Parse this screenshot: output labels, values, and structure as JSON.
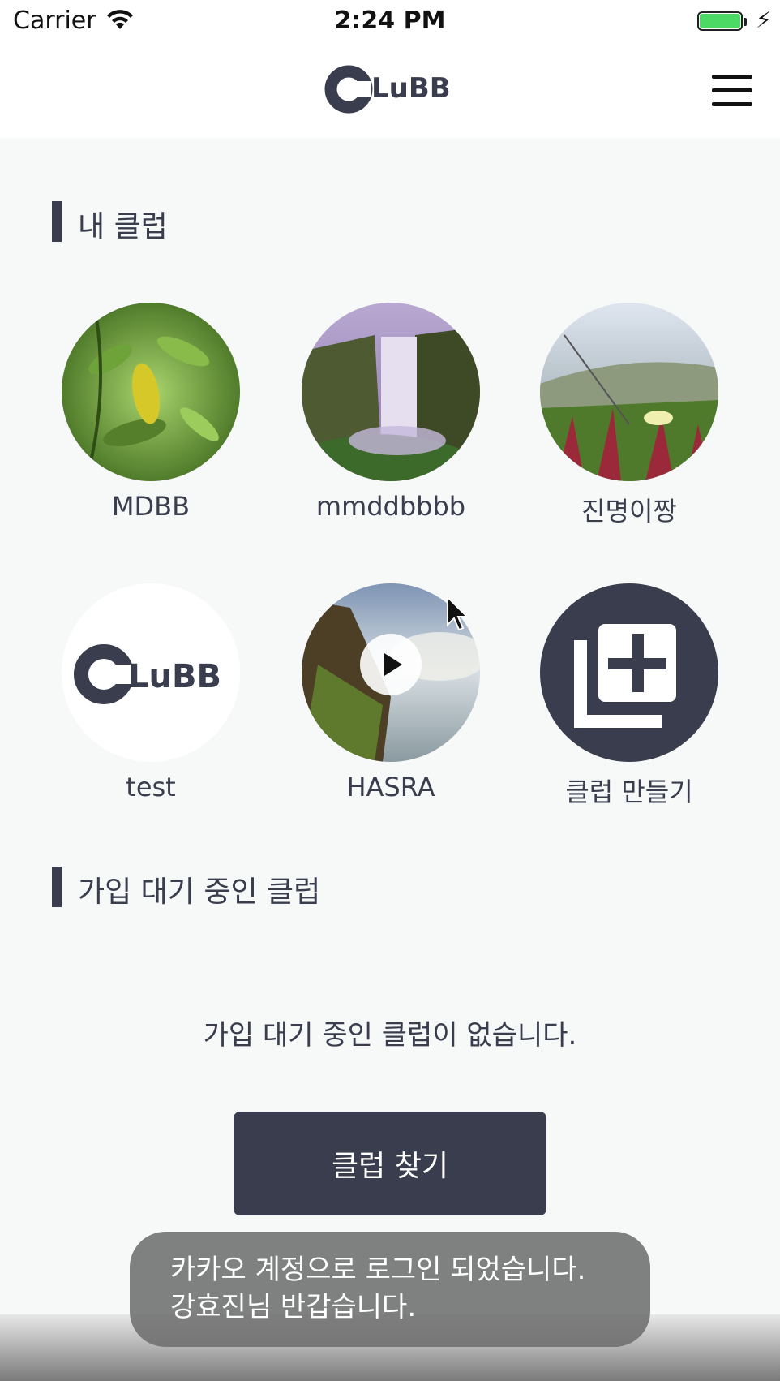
{
  "status_bar": {
    "carrier": "Carrier",
    "time": "2:24 PM"
  },
  "header": {
    "logo_text": "CLuBB",
    "menu_icon": "hamburger-menu-icon"
  },
  "my_clubs": {
    "title": "내 클럽",
    "items": [
      {
        "name": "MDBB",
        "image": "green-leaves-photo"
      },
      {
        "name": "mmddbbbb",
        "image": "waterfall-photo"
      },
      {
        "name": "진명이짱",
        "image": "flower-field-photo"
      },
      {
        "name": "test",
        "image": "clubb-logo"
      },
      {
        "name": "HASRA",
        "image": "video-thumbnail"
      },
      {
        "name": "클럽 만들기",
        "image": "add-club-icon"
      }
    ]
  },
  "pending_clubs": {
    "title": "가입 대기 중인 클럽",
    "empty_message": "가입 대기 중인 클럽이 없습니다.",
    "find_button": "클럽 찾기"
  },
  "toast": {
    "line1": "카카오 계정으로 로그인 되었습니다.",
    "line2": "강효진님 반갑습니다."
  },
  "colors": {
    "primary": "#3a3d4d",
    "background": "#f7f8f8",
    "battery": "#4cd964"
  }
}
